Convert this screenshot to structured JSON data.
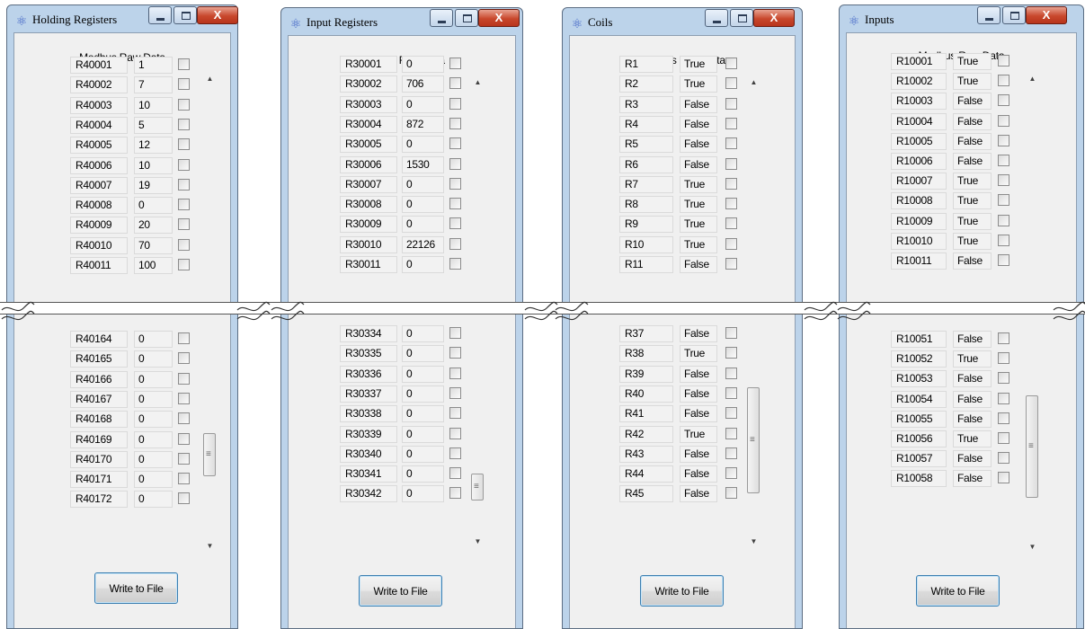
{
  "windows": [
    {
      "id": "holding",
      "title": "Holding Registers",
      "heading": "Modbus Raw Data",
      "button_label": "Write to File",
      "close_glyph": "X",
      "rows_top": [
        {
          "addr": "R40001",
          "value": "1"
        },
        {
          "addr": "R40002",
          "value": "7"
        },
        {
          "addr": "R40003",
          "value": "10"
        },
        {
          "addr": "R40004",
          "value": "5"
        },
        {
          "addr": "R40005",
          "value": "12"
        },
        {
          "addr": "R40006",
          "value": "10"
        },
        {
          "addr": "R40007",
          "value": "19"
        },
        {
          "addr": "R40008",
          "value": "0"
        },
        {
          "addr": "R40009",
          "value": "20"
        },
        {
          "addr": "R40010",
          "value": "70"
        },
        {
          "addr": "R40011",
          "value": "100"
        }
      ],
      "rows_bottom": [
        {
          "addr": "R40164",
          "value": "0"
        },
        {
          "addr": "R40165",
          "value": "0"
        },
        {
          "addr": "R40166",
          "value": "0"
        },
        {
          "addr": "R40167",
          "value": "0"
        },
        {
          "addr": "R40168",
          "value": "0"
        },
        {
          "addr": "R40169",
          "value": "0"
        },
        {
          "addr": "R40170",
          "value": "0"
        },
        {
          "addr": "R40171",
          "value": "0"
        },
        {
          "addr": "R40172",
          "value": "0"
        }
      ]
    },
    {
      "id": "input",
      "title": "Input Registers",
      "heading": "Modbus Raw Data",
      "button_label": "Write to File",
      "close_glyph": "X",
      "rows_top": [
        {
          "addr": "R30001",
          "value": "0"
        },
        {
          "addr": "R30002",
          "value": "706"
        },
        {
          "addr": "R30003",
          "value": "0"
        },
        {
          "addr": "R30004",
          "value": "872"
        },
        {
          "addr": "R30005",
          "value": "0"
        },
        {
          "addr": "R30006",
          "value": "1530"
        },
        {
          "addr": "R30007",
          "value": "0"
        },
        {
          "addr": "R30008",
          "value": "0"
        },
        {
          "addr": "R30009",
          "value": "0"
        },
        {
          "addr": "R30010",
          "value": "22126"
        },
        {
          "addr": "R30011",
          "value": "0"
        }
      ],
      "rows_bottom": [
        {
          "addr": "R30334",
          "value": "0"
        },
        {
          "addr": "R30335",
          "value": "0"
        },
        {
          "addr": "R30336",
          "value": "0"
        },
        {
          "addr": "R30337",
          "value": "0"
        },
        {
          "addr": "R30338",
          "value": "0"
        },
        {
          "addr": "R30339",
          "value": "0"
        },
        {
          "addr": "R30340",
          "value": "0"
        },
        {
          "addr": "R30341",
          "value": "0"
        },
        {
          "addr": "R30342",
          "value": "0"
        }
      ]
    },
    {
      "id": "coils",
      "title": "Coils",
      "heading": "Modbus Raw Data",
      "button_label": "Write to File",
      "close_glyph": "X",
      "rows_top": [
        {
          "addr": "R1",
          "value": "True"
        },
        {
          "addr": "R2",
          "value": "True"
        },
        {
          "addr": "R3",
          "value": "False"
        },
        {
          "addr": "R4",
          "value": "False"
        },
        {
          "addr": "R5",
          "value": "False"
        },
        {
          "addr": "R6",
          "value": "False"
        },
        {
          "addr": "R7",
          "value": "True"
        },
        {
          "addr": "R8",
          "value": "True"
        },
        {
          "addr": "R9",
          "value": "True"
        },
        {
          "addr": "R10",
          "value": "True"
        },
        {
          "addr": "R11",
          "value": "False"
        }
      ],
      "rows_bottom": [
        {
          "addr": "R37",
          "value": "False"
        },
        {
          "addr": "R38",
          "value": "True"
        },
        {
          "addr": "R39",
          "value": "False"
        },
        {
          "addr": "R40",
          "value": "False"
        },
        {
          "addr": "R41",
          "value": "False"
        },
        {
          "addr": "R42",
          "value": "True"
        },
        {
          "addr": "R43",
          "value": "False"
        },
        {
          "addr": "R44",
          "value": "False"
        },
        {
          "addr": "R45",
          "value": "False"
        }
      ]
    },
    {
      "id": "inputs",
      "title": "Inputs",
      "heading": "Modbus Raw Data",
      "button_label": "Write to File",
      "close_glyph": "X",
      "rows_top": [
        {
          "addr": "R10001",
          "value": "True"
        },
        {
          "addr": "R10002",
          "value": "True"
        },
        {
          "addr": "R10003",
          "value": "False"
        },
        {
          "addr": "R10004",
          "value": "False"
        },
        {
          "addr": "R10005",
          "value": "False"
        },
        {
          "addr": "R10006",
          "value": "False"
        },
        {
          "addr": "R10007",
          "value": "True"
        },
        {
          "addr": "R10008",
          "value": "True"
        },
        {
          "addr": "R10009",
          "value": "True"
        },
        {
          "addr": "R10010",
          "value": "True"
        },
        {
          "addr": "R10011",
          "value": "False"
        }
      ],
      "rows_bottom": [
        {
          "addr": "R10051",
          "value": "False"
        },
        {
          "addr": "R10052",
          "value": "True"
        },
        {
          "addr": "R10053",
          "value": "False"
        },
        {
          "addr": "R10054",
          "value": "False"
        },
        {
          "addr": "R10055",
          "value": "False"
        },
        {
          "addr": "R10056",
          "value": "True"
        },
        {
          "addr": "R10057",
          "value": "False"
        },
        {
          "addr": "R10058",
          "value": "False"
        }
      ]
    }
  ],
  "icons": {
    "app": "atom-icon",
    "minimize": "minimize-icon",
    "maximize": "maximize-icon",
    "close": "close-icon",
    "scroll_up": "arrow-up-icon",
    "scroll_down": "arrow-down-icon",
    "scroll_grip": "grip-icon"
  },
  "colors": {
    "frame": "#bcd3ea",
    "client": "#f0f0f0",
    "close_button": "#c8472c",
    "button_border": "#3c7fb1"
  }
}
